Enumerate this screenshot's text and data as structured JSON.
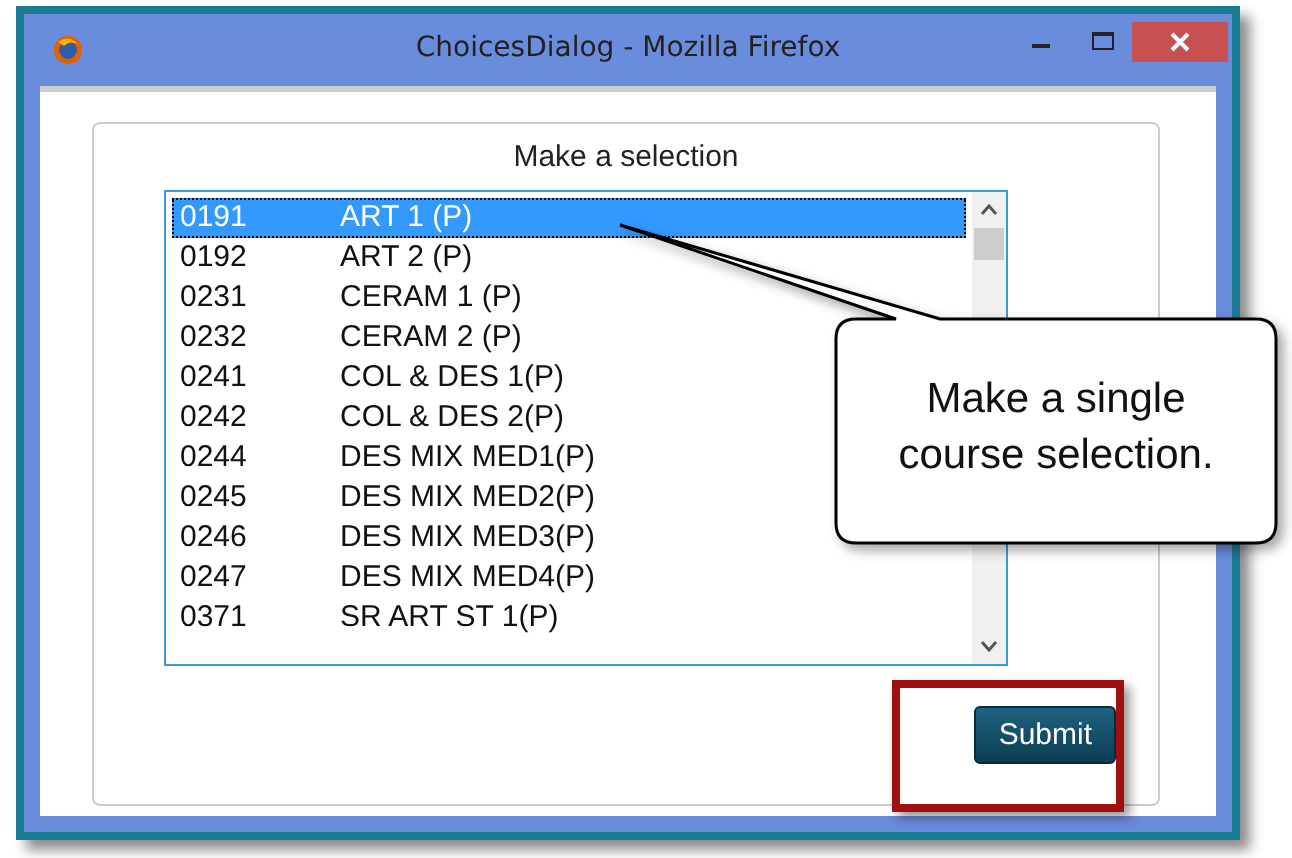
{
  "window": {
    "title": "ChoicesDialog - Mozilla Firefox"
  },
  "dialog": {
    "heading": "Make a selection",
    "submit": "Submit"
  },
  "courses": [
    {
      "code": "0191",
      "name": "ART 1 (P)",
      "selected": true
    },
    {
      "code": "0192",
      "name": "ART 2 (P)",
      "selected": false
    },
    {
      "code": "0231",
      "name": "CERAM 1 (P)",
      "selected": false
    },
    {
      "code": "0232",
      "name": "CERAM 2 (P)",
      "selected": false
    },
    {
      "code": "0241",
      "name": "COL & DES 1(P)",
      "selected": false
    },
    {
      "code": "0242",
      "name": "COL & DES 2(P)",
      "selected": false
    },
    {
      "code": "0244",
      "name": "DES MIX MED1(P)",
      "selected": false
    },
    {
      "code": "0245",
      "name": "DES MIX MED2(P)",
      "selected": false
    },
    {
      "code": "0246",
      "name": "DES MIX MED3(P)",
      "selected": false
    },
    {
      "code": "0247",
      "name": "DES MIX MED4(P)",
      "selected": false
    },
    {
      "code": "0371",
      "name": "SR ART ST 1(P)",
      "selected": false
    }
  ],
  "callout": {
    "text": "Make a single course selection."
  }
}
